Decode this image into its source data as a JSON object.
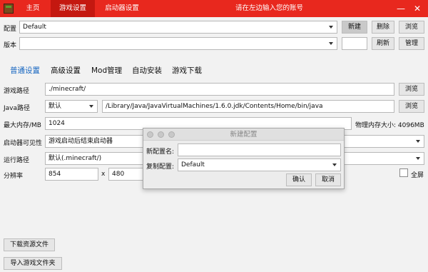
{
  "titlebar": {
    "tabs": [
      {
        "label": "主页"
      },
      {
        "label": "游戏设置"
      },
      {
        "label": "启动器设置"
      }
    ],
    "hint": "请在左边输入您的账号",
    "minimize_label": "—",
    "close_label": "✕"
  },
  "config_row": {
    "label": "配置",
    "selected": "Default",
    "new_label": "新建",
    "delete_label": "删除",
    "browse_label": "浏览"
  },
  "version_row": {
    "label": "版本",
    "selected": "",
    "version_input": "",
    "refresh_label": "刷新",
    "manage_label": "管理"
  },
  "subtabs": [
    {
      "label": "普通设置"
    },
    {
      "label": "高级设置"
    },
    {
      "label": "Mod管理"
    },
    {
      "label": "自动安装"
    },
    {
      "label": "游戏下载"
    }
  ],
  "game_path": {
    "label": "游戏路径",
    "value": "./minecraft/",
    "browse_label": "浏览"
  },
  "java_path": {
    "label": "Java路径",
    "mode": "默认",
    "value": "/Library/Java/JavaVirtualMachines/1.6.0.jdk/Contents/Home/bin/java",
    "browse_label": "浏览"
  },
  "memory": {
    "label": "最大内存/MB",
    "value": "1024",
    "physical": "物理内存大小: 4096MB"
  },
  "visibility": {
    "label": "启动器可见性",
    "selected": "游戏启动后结束启动器"
  },
  "run_path": {
    "label": "运行路径",
    "selected": "默认(.minecraft/)"
  },
  "resolution": {
    "label": "分辨率",
    "width": "854",
    "sep": "x",
    "height": "480",
    "fullscreen_label": "全屏"
  },
  "bottom_buttons": {
    "download_assets": "下载资源文件",
    "import_folder": "导入游戏文件夹"
  },
  "dialog": {
    "title": "新建配置",
    "name_label": "新配置名:",
    "name_value": "",
    "copy_label": "复制配置:",
    "copy_selected": "Default",
    "confirm_label": "确认",
    "cancel_label": "取消"
  },
  "colors": {
    "titlebar": "#e8281e",
    "active_tab": "#c41810",
    "subtab_active": "#1565c0"
  }
}
